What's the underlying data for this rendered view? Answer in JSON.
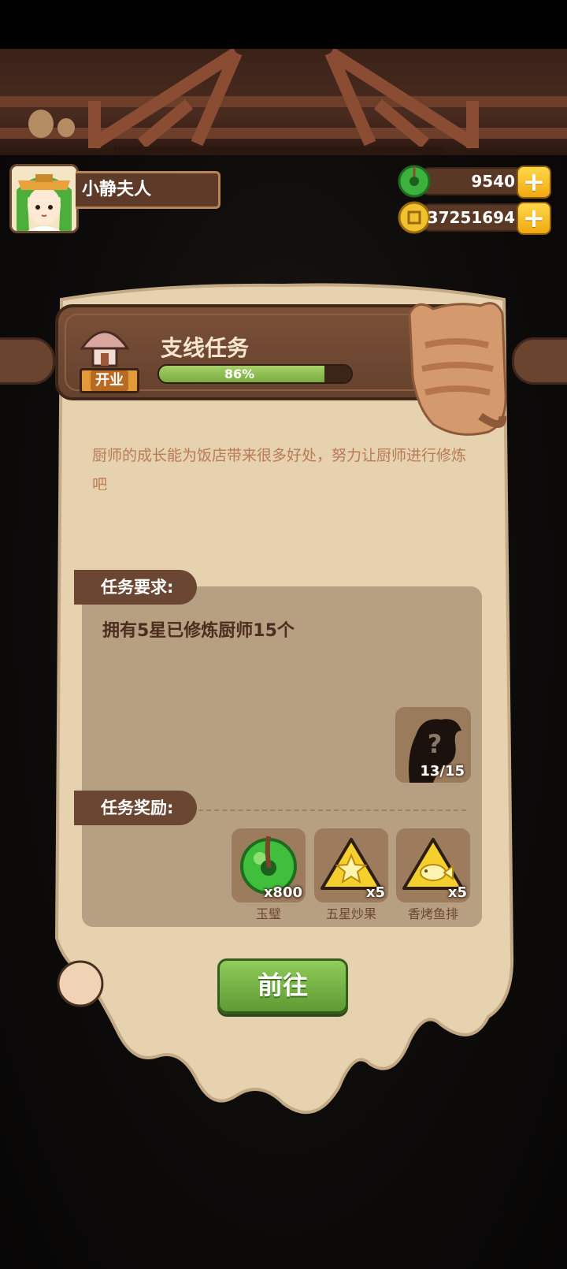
{
  "player": {
    "name": "小静夫人"
  },
  "currencies": [
    {
      "name": "jade",
      "value": "9540",
      "icon": "jade-disc-icon",
      "color": "#3cb23c"
    },
    {
      "name": "coins",
      "value": "37251694",
      "icon": "gold-coin-icon",
      "color": "#f2c12e"
    }
  ],
  "task": {
    "badge": "开业",
    "title": "支线任务",
    "progress_percent": 86,
    "progress_label": "86%",
    "description": "厨师的成长能为饭店带来很多好处，努力让厨师进行修炼吧",
    "requirement_tab": "任务要求:",
    "requirement_text": "拥有5星已修炼厨师15个",
    "requirement_count": "13/15",
    "reward_tab": "任务奖励:",
    "rewards": [
      {
        "label": "玉璧",
        "qty": "x800",
        "icon": "jade-disc-icon"
      },
      {
        "label": "五星炒果",
        "qty": "x5",
        "icon": "star-dish-icon"
      },
      {
        "label": "香烤鱼排",
        "qty": "x5",
        "icon": "fish-dish-icon"
      }
    ],
    "go_button": "前往"
  },
  "colors": {
    "accent_green": "#79ad3f",
    "panel_parchment": "#e6d2ae",
    "wood": "#6b4430"
  }
}
